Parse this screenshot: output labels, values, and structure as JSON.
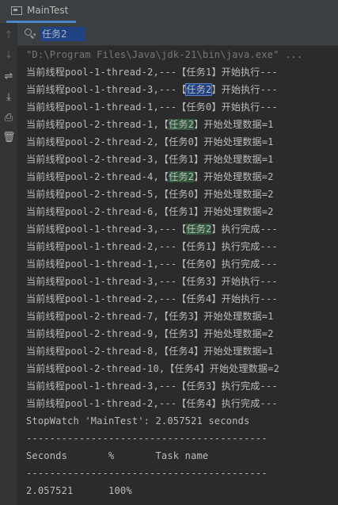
{
  "tab": {
    "title": "MainTest",
    "icon": "console-icon"
  },
  "search": {
    "value": "任务2",
    "placeholder": ""
  },
  "gutter": [
    {
      "icon": "up-arrow-icon",
      "glyph": "↑",
      "active": false
    },
    {
      "icon": "down-arrow-icon",
      "glyph": "↓",
      "active": false
    },
    {
      "icon": "soft-wrap-icon",
      "glyph": "⇌",
      "active": true
    },
    {
      "icon": "scroll-to-end-icon",
      "glyph": "⤓",
      "active": true
    },
    {
      "icon": "print-icon",
      "glyph": "⎙",
      "active": true
    },
    {
      "icon": "trash-icon",
      "glyph": "🗑",
      "active": true
    }
  ],
  "console": {
    "lines": [
      {
        "kind": "cmd",
        "parts": [
          {
            "t": "\"D:\\Program Files\\Java\\jdk-21\\bin\\java.exe\" ..."
          }
        ]
      },
      {
        "parts": [
          {
            "t": "当前线程pool-1-thread-2,---【任务1】开始执行---"
          }
        ]
      },
      {
        "parts": [
          {
            "t": "当前线程pool-1-thread-3,---【"
          },
          {
            "t": "任务2",
            "hl": "sel"
          },
          {
            "t": "】开始执行---"
          }
        ]
      },
      {
        "parts": [
          {
            "t": "当前线程pool-1-thread-1,---【任务0】开始执行---"
          }
        ]
      },
      {
        "parts": [
          {
            "t": "当前线程pool-2-thread-1,【"
          },
          {
            "t": "任务2",
            "hl": "green"
          },
          {
            "t": "】开始处理数据=1"
          }
        ]
      },
      {
        "parts": [
          {
            "t": "当前线程pool-2-thread-2,【任务0】开始处理数据=1"
          }
        ]
      },
      {
        "parts": [
          {
            "t": "当前线程pool-2-thread-3,【任务1】开始处理数据=1"
          }
        ]
      },
      {
        "parts": [
          {
            "t": "当前线程pool-2-thread-4,【"
          },
          {
            "t": "任务2",
            "hl": "green"
          },
          {
            "t": "】开始处理数据=2"
          }
        ]
      },
      {
        "parts": [
          {
            "t": "当前线程pool-2-thread-5,【任务0】开始处理数据=2"
          }
        ]
      },
      {
        "parts": [
          {
            "t": "当前线程pool-2-thread-6,【任务1】开始处理数据=2"
          }
        ]
      },
      {
        "parts": [
          {
            "t": "当前线程pool-1-thread-3,---【"
          },
          {
            "t": "任务2",
            "hl": "green"
          },
          {
            "t": "】执行完成---"
          }
        ]
      },
      {
        "parts": [
          {
            "t": "当前线程pool-1-thread-2,---【任务1】执行完成---"
          }
        ]
      },
      {
        "parts": [
          {
            "t": "当前线程pool-1-thread-1,---【任务0】执行完成---"
          }
        ]
      },
      {
        "parts": [
          {
            "t": "当前线程pool-1-thread-3,---【任务3】开始执行---"
          }
        ]
      },
      {
        "parts": [
          {
            "t": "当前线程pool-1-thread-2,---【任务4】开始执行---"
          }
        ]
      },
      {
        "parts": [
          {
            "t": "当前线程pool-2-thread-7,【任务3】开始处理数据=1"
          }
        ]
      },
      {
        "parts": [
          {
            "t": "当前线程pool-2-thread-9,【任务3】开始处理数据=2"
          }
        ]
      },
      {
        "parts": [
          {
            "t": "当前线程pool-2-thread-8,【任务4】开始处理数据=1"
          }
        ]
      },
      {
        "parts": [
          {
            "t": "当前线程pool-2-thread-10,【任务4】开始处理数据=2"
          }
        ]
      },
      {
        "parts": [
          {
            "t": "当前线程pool-1-thread-3,---【任务3】执行完成---"
          }
        ]
      },
      {
        "parts": [
          {
            "t": "当前线程pool-1-thread-2,---【任务4】执行完成---"
          }
        ]
      },
      {
        "parts": [
          {
            "t": "StopWatch 'MainTest': 2.057521 seconds"
          }
        ]
      },
      {
        "parts": [
          {
            "t": "-----------------------------------------"
          }
        ]
      },
      {
        "parts": [
          {
            "t": "Seconds       %       Task name"
          }
        ]
      },
      {
        "parts": [
          {
            "t": "-----------------------------------------"
          }
        ]
      },
      {
        "parts": [
          {
            "t": "2.057521      100%"
          }
        ]
      }
    ]
  }
}
